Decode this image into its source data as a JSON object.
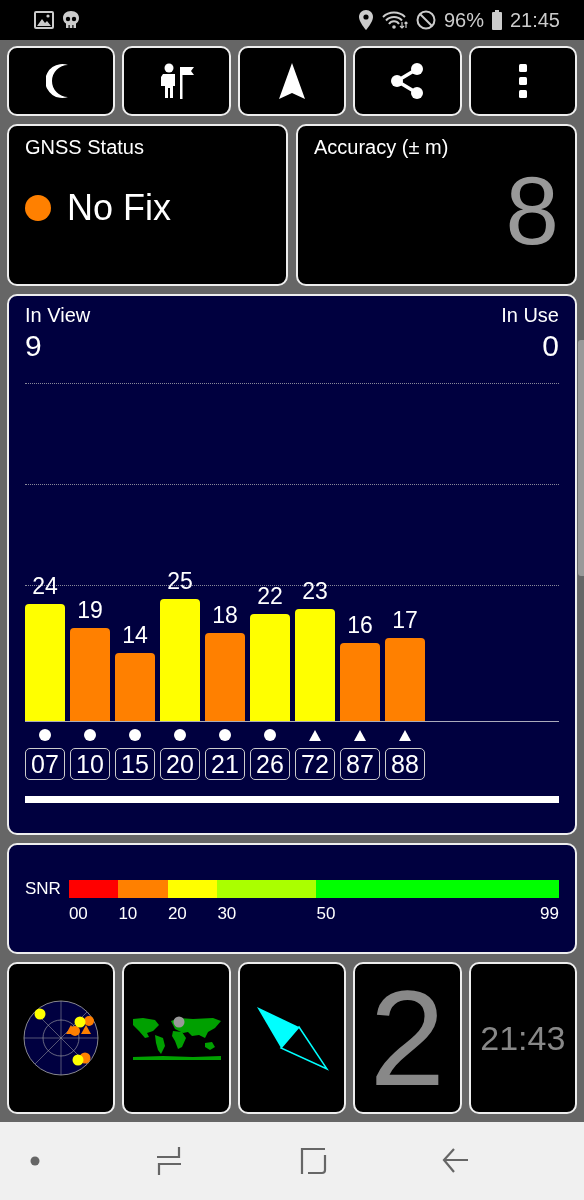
{
  "status_bar": {
    "battery": "96%",
    "time": "21:45"
  },
  "toolbar": [
    {
      "kind": "night"
    },
    {
      "kind": "guide"
    },
    {
      "kind": "navigate"
    },
    {
      "kind": "share"
    },
    {
      "kind": "menu"
    }
  ],
  "gnss_status": {
    "title": "GNSS Status",
    "fix": "No Fix",
    "color": "#ff8000"
  },
  "accuracy": {
    "title": "Accuracy (± m)",
    "value": "8"
  },
  "sky_view": {
    "in_view_label": "In View",
    "in_view": "9",
    "in_use_label": "In Use",
    "in_use": "0",
    "satellites": [
      {
        "id": "07",
        "snr": "24",
        "color": "#ffff00",
        "kind": "circle"
      },
      {
        "id": "10",
        "snr": "19",
        "color": "#ff8000",
        "kind": "circle"
      },
      {
        "id": "15",
        "snr": "14",
        "color": "#ff8000",
        "kind": "circle"
      },
      {
        "id": "20",
        "snr": "25",
        "color": "#ffff00",
        "kind": "circle"
      },
      {
        "id": "21",
        "snr": "18",
        "color": "#ff8000",
        "kind": "circle"
      },
      {
        "id": "26",
        "snr": "22",
        "color": "#ffff00",
        "kind": "circle"
      },
      {
        "id": "72",
        "snr": "23",
        "color": "#ffff00",
        "kind": "triangle"
      },
      {
        "id": "87",
        "snr": "16",
        "color": "#ff8000",
        "kind": "triangle"
      },
      {
        "id": "88",
        "snr": "17",
        "color": "#ff8000",
        "kind": "triangle"
      }
    ]
  },
  "snr_legend": {
    "label": "SNR",
    "segments": [
      {
        "color": "#ff0000"
      },
      {
        "color": "#ff8000"
      },
      {
        "color": "#ffff00"
      },
      {
        "color": "#aaff00"
      },
      {
        "color": "#00ff00"
      }
    ],
    "ticks": [
      "00",
      "10",
      "20",
      "30",
      "50",
      "99"
    ]
  },
  "tiles": [
    {
      "kind": "radar"
    },
    {
      "kind": "map"
    },
    {
      "kind": "compass"
    },
    {
      "kind": "number",
      "value": "2"
    },
    {
      "kind": "clock",
      "value": "21:43"
    }
  ]
}
